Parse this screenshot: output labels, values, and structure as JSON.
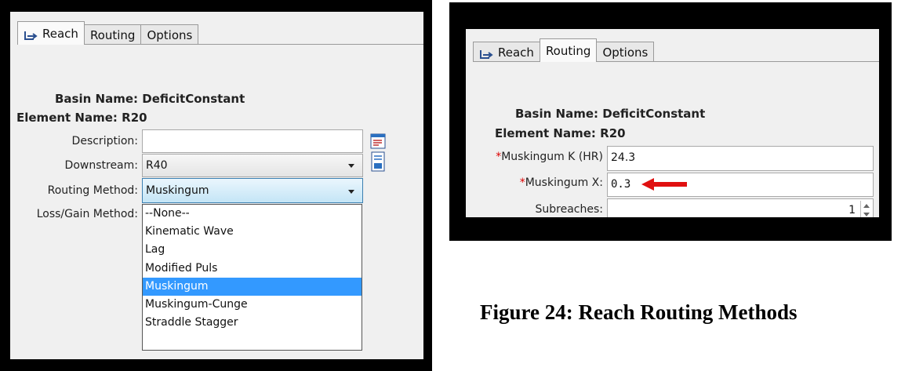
{
  "colors": {
    "frame": "#000000",
    "panel": "#f0f0f0",
    "selection": "#3399ff",
    "required": "#dd0000",
    "arrow": "#e01010"
  },
  "left_panel": {
    "tabs": [
      {
        "label": "Reach",
        "icon": "reach-icon"
      },
      {
        "label": "Routing"
      },
      {
        "label": "Options"
      }
    ],
    "active_tab": "Reach",
    "basin_name_label": "Basin Name:",
    "basin_name_value": "DeficitConstant",
    "element_name_label": "Element Name:",
    "element_name_value": "R20",
    "description_label": "Description:",
    "description_value": "",
    "downstream_label": "Downstream:",
    "downstream_value": "R40",
    "routing_method_label": "Routing Method:",
    "routing_method_value": "Muskingum",
    "loss_gain_label": "Loss/Gain Method:",
    "dropdown_options": [
      "--None--",
      "Kinematic Wave",
      "Lag",
      "Modified Puls",
      "Muskingum",
      "Muskingum-Cunge",
      "Straddle Stagger"
    ],
    "dropdown_selected": "Muskingum"
  },
  "right_panel": {
    "tabs": [
      {
        "label": "Reach",
        "icon": "reach-icon"
      },
      {
        "label": "Routing"
      },
      {
        "label": "Options"
      }
    ],
    "active_tab": "Routing",
    "basin_name_label": "Basin Name:",
    "basin_name_value": "DeficitConstant",
    "element_name_label": "Element Name:",
    "element_name_value": "R20",
    "required_marker": "*",
    "muskingum_k_label": "Muskingum K (HR)",
    "muskingum_k_value": "24.3",
    "muskingum_x_label": "Muskingum X:",
    "muskingum_x_value": "0.3",
    "subreaches_label": "Subreaches:",
    "subreaches_value": "1"
  },
  "caption": "Figure 24: Reach Routing Methods"
}
